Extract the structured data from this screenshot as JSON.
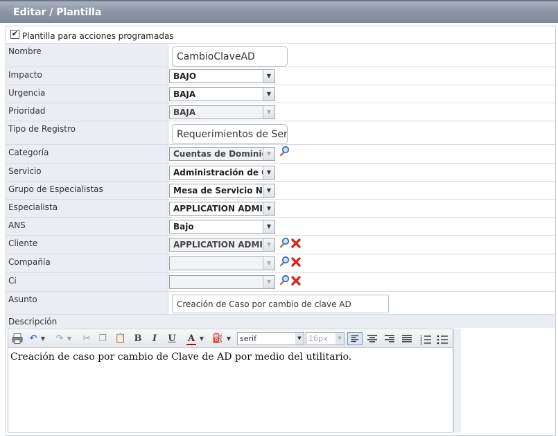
{
  "header": {
    "title": "Editar / Plantilla"
  },
  "template_checkbox": {
    "label": "Plantilla para acciones programadas",
    "checked": true
  },
  "fields": {
    "nombre": {
      "label": "Nombre",
      "value": "CambioClaveAD"
    },
    "impacto": {
      "label": "Impacto",
      "value": "BAJO"
    },
    "urgencia": {
      "label": "Urgencia",
      "value": "BAJA"
    },
    "prioridad": {
      "label": "Prioridad",
      "value": "BAJA"
    },
    "tipo_registro": {
      "label": "Tipo de Registro",
      "value": "Requerimientos de Servi"
    },
    "categoria": {
      "label": "Categoría",
      "value": "Cuentas de Dominio"
    },
    "servicio": {
      "label": "Servicio",
      "value": "Administración de Cuer"
    },
    "grupo": {
      "label": "Grupo de Especialistas",
      "value": "Mesa de Servicio Nivel"
    },
    "especialista": {
      "label": "Especialista",
      "value": "APPLICATION ADMINIST"
    },
    "ans": {
      "label": "ANS",
      "value": "Bajo"
    },
    "cliente": {
      "label": "Cliente",
      "value": "APPLICATION ADMINIST"
    },
    "compania": {
      "label": "Compañía",
      "value": ""
    },
    "ci": {
      "label": "Ci",
      "value": ""
    },
    "asunto": {
      "label": "Asunto",
      "value": "Creación de Caso por cambio de clave AD"
    },
    "descripcion": {
      "label": "Descripción"
    }
  },
  "editor": {
    "font_family": "serif",
    "font_size": "16px",
    "content": "Creación de caso por cambio de Clave de AD por medio del utilitario.",
    "buttons": {
      "bold": "B",
      "italic": "I",
      "underline": "U",
      "font_color": "A"
    }
  },
  "colors": {
    "header_bg": "#8e98a9",
    "label_bg": "#eaedf1",
    "search": "#2f6fc2",
    "delete": "#d8261c"
  },
  "icons": [
    "search-icon",
    "delete-icon",
    "checkbox-icon",
    "print-icon",
    "undo-icon",
    "redo-icon",
    "cut-icon",
    "copy-icon",
    "paste-icon",
    "paint-bucket-icon",
    "align-left-icon",
    "align-center-icon",
    "align-right-icon",
    "justify-icon",
    "numbered-list-icon",
    "bullet-list-icon"
  ]
}
